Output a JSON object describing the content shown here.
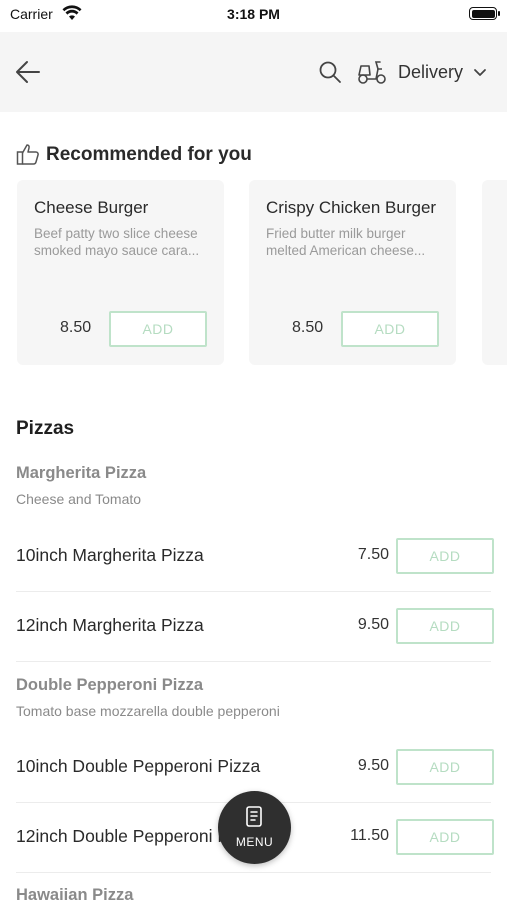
{
  "status_bar": {
    "carrier": "Carrier",
    "time": "3:18 PM"
  },
  "navbar": {
    "delivery_label": "Delivery"
  },
  "recommended": {
    "title": "Recommended for you",
    "items": [
      {
        "name": "Cheese Burger",
        "description": "Beef patty two slice cheese smoked mayo sauce cara...",
        "price": "8.50",
        "add_label": "ADD"
      },
      {
        "name": "Crispy Chicken Burger",
        "description": "Fried butter milk burger melted American cheese...",
        "price": "8.50",
        "add_label": "ADD"
      }
    ]
  },
  "menu_section": {
    "title": "Pizzas",
    "groups": [
      {
        "name": "Margherita Pizza",
        "description": "Cheese and Tomato",
        "items": [
          {
            "name": "10inch Margherita Pizza",
            "price": "7.50",
            "add_label": "ADD"
          },
          {
            "name": "12inch Margherita Pizza",
            "price": "9.50",
            "add_label": "ADD"
          }
        ]
      },
      {
        "name": "Double Pepperoni Pizza",
        "description": "Tomato base mozzarella double pepperoni",
        "items": [
          {
            "name": "10inch Double Pepperoni Pizza",
            "price": "9.50",
            "add_label": "ADD"
          },
          {
            "name": "12inch Double Pepperoni Pizza",
            "price": "11.50",
            "add_label": "ADD"
          }
        ]
      },
      {
        "name": "Hawaiian Pizza"
      }
    ]
  },
  "fab": {
    "label": "MENU"
  },
  "colors": {
    "add_border": "#bfe3ca",
    "add_text": "#b5dcc1",
    "fab_bg": "#2f2f2f",
    "navbar_bg": "#f5f5f5"
  }
}
